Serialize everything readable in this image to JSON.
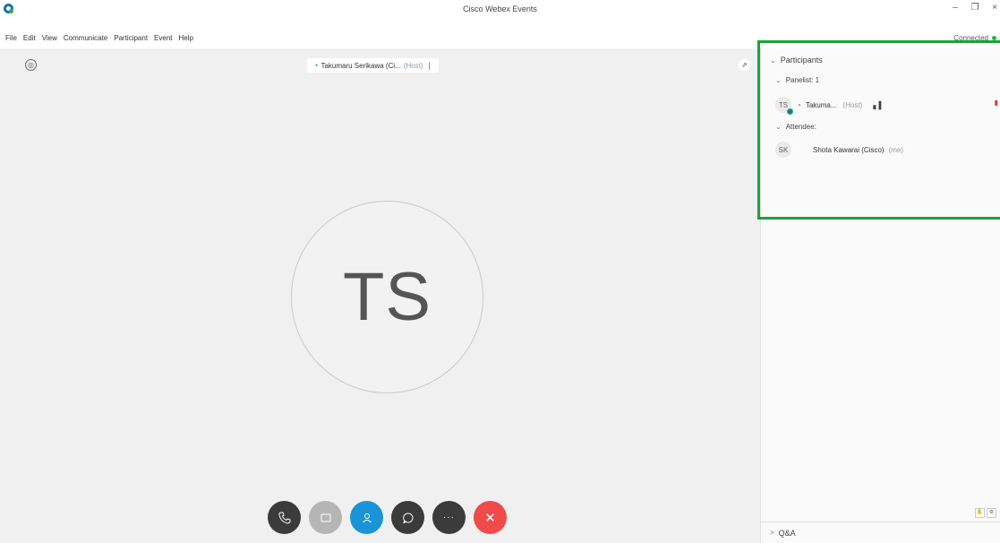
{
  "window": {
    "title": "Cisco Webex Events",
    "controls": {
      "minimize": "–",
      "restore": "❐",
      "close": "×"
    }
  },
  "menu": [
    "File",
    "Edit",
    "View",
    "Communicate",
    "Participant",
    "Event",
    "Help"
  ],
  "status": {
    "connected": "Connected"
  },
  "stage": {
    "host_name": "Takumaru Serikawa (Ci...",
    "host_tag": "(Host)",
    "avatar_initials": "TS"
  },
  "controls": {
    "audio": "phone-icon",
    "video": "video-icon",
    "participants": "person-icon",
    "chat": "chat-icon",
    "more": "more-icon",
    "leave": "close-icon"
  },
  "panel": {
    "participants_header": "Participants",
    "panelist_header": "Panelist: 1",
    "panelist": {
      "initials": "TS",
      "name": "Takuma...",
      "tag": "(Host)"
    },
    "attendee_header": "Attendee:",
    "attendee": {
      "initials": "SK",
      "name": "Shota Kawarai (Cisco)",
      "tag": "(me)"
    },
    "qa_header": "Q&A"
  },
  "colors": {
    "highlight": "#1ca23d",
    "participants_button": "#1a94d6",
    "leave_button": "#f04a4a",
    "dark_button": "#3b3b3b"
  }
}
